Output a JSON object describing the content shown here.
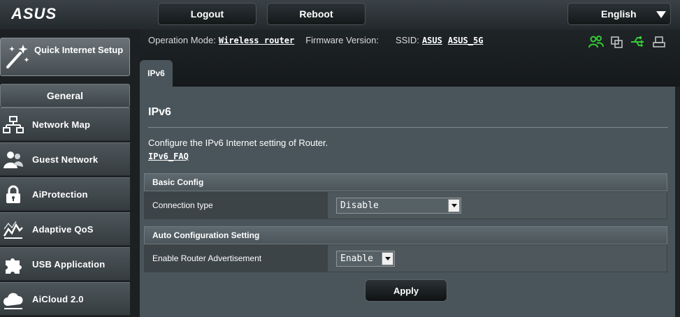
{
  "header": {
    "logo_text": "ASUS",
    "logout_label": "Logout",
    "reboot_label": "Reboot",
    "language": "English"
  },
  "status": {
    "operation_mode_label": "Operation Mode:",
    "operation_mode_value": "Wireless router",
    "firmware_label": "Firmware Version:",
    "ssid_label": "SSID:",
    "ssid_1": "ASUS",
    "ssid_2": "ASUS_5G",
    "icons": [
      "clients-icon",
      "app-icon",
      "usb-icon",
      "printer-icon"
    ]
  },
  "tabs": [
    {
      "label": "IPv6"
    }
  ],
  "sidebar": {
    "quick_setup": "Quick Internet Setup",
    "section_title": "General",
    "items": [
      {
        "label": "Network Map",
        "icon": "network-map-icon"
      },
      {
        "label": "Guest Network",
        "icon": "guest-network-icon"
      },
      {
        "label": "AiProtection",
        "icon": "lock-icon"
      },
      {
        "label": "Adaptive QoS",
        "icon": "qos-icon"
      },
      {
        "label": "USB Application",
        "icon": "puzzle-icon"
      },
      {
        "label": "AiCloud 2.0",
        "icon": "cloud-icon"
      }
    ]
  },
  "main": {
    "title": "IPv6",
    "description": "Configure the IPv6 Internet setting of Router.",
    "faq_link": "IPv6_FAQ",
    "sections": [
      {
        "header": "Basic Config",
        "row_label": "Connection type",
        "value": "Disable"
      },
      {
        "header": "Auto Configuration Setting",
        "row_label": "Enable Router Advertisement",
        "value": "Enable"
      }
    ],
    "apply_label": "Apply"
  },
  "colors": {
    "status_icon_green": "#33cc33",
    "panel": "#4a555b",
    "background": "#1e2225"
  }
}
